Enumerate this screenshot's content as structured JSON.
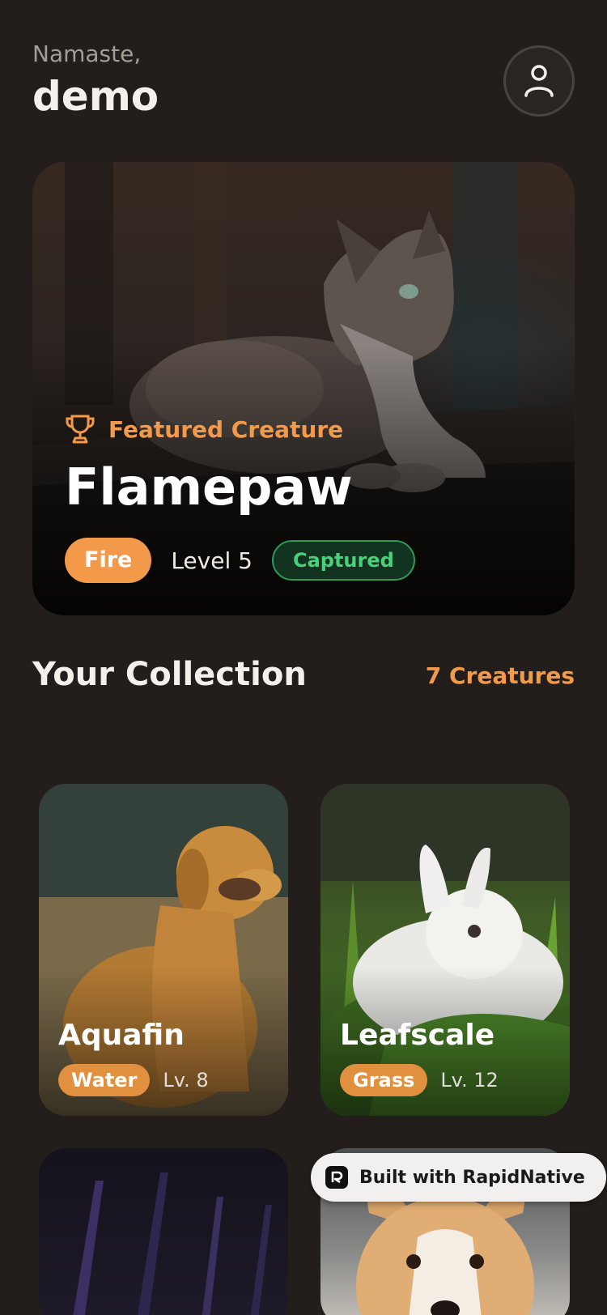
{
  "header": {
    "greeting": "Namaste,",
    "username": "demo",
    "profile_icon": "user-icon"
  },
  "featured": {
    "tag_icon": "trophy-icon",
    "tag_label": "Featured Creature",
    "name": "Flamepaw",
    "type": "Fire",
    "level": "Level 5",
    "status": "Captured",
    "image_subject": "cat"
  },
  "collection": {
    "title": "Your Collection",
    "count": "7 Creatures",
    "items": [
      {
        "name": "Aquafin",
        "type": "Water",
        "level": "Lv. 8",
        "image_subject": "golden-retriever"
      },
      {
        "name": "Leafscale",
        "type": "Grass",
        "level": "Lv. 12",
        "image_subject": "white-rabbit"
      },
      {
        "name": "",
        "type": "",
        "level": "",
        "image_subject": "dark-purple-abstract"
      },
      {
        "name": "",
        "type": "",
        "level": "",
        "image_subject": "corgi"
      }
    ]
  },
  "badge": {
    "label": "Built with RapidNative",
    "icon": "rapidnative-logo-icon"
  },
  "colors": {
    "background": "#231e1b",
    "accent": "#f39a4a",
    "captured_green": "#48d07a",
    "card_pill": "#e0903e"
  }
}
